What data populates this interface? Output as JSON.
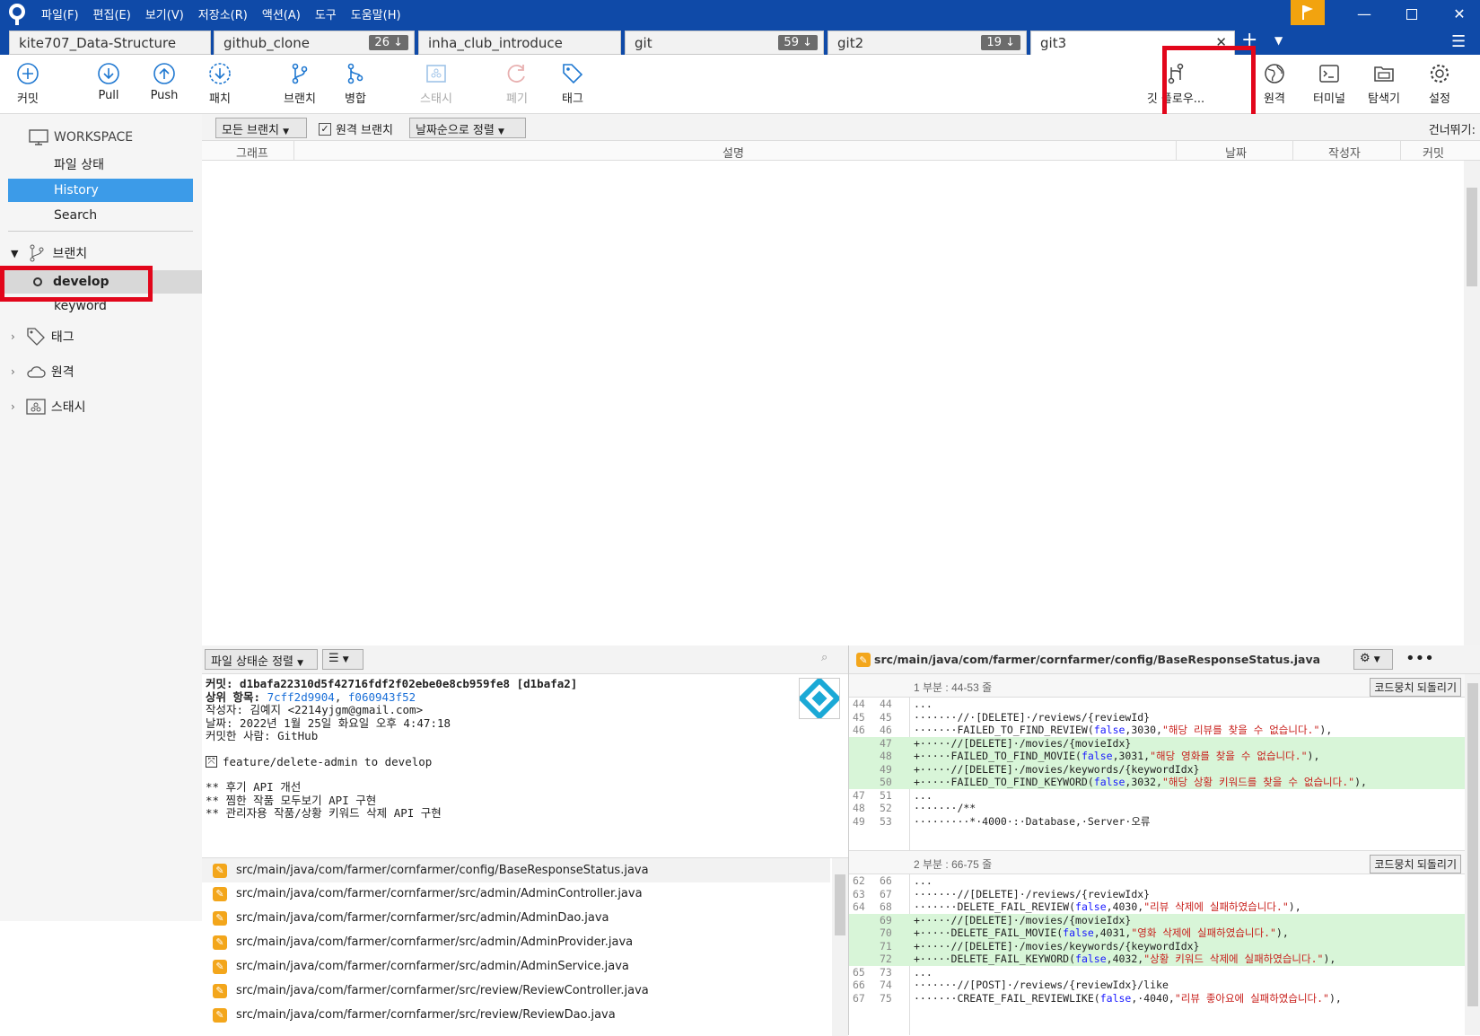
{
  "menu": [
    "파일(F)",
    "편집(E)",
    "보기(V)",
    "저장소(R)",
    "액션(A)",
    "도구",
    "도움말(H)"
  ],
  "tabs": [
    {
      "name": "kite707_Data-Structure",
      "badge": ""
    },
    {
      "name": "github_clone",
      "badge": "26 ↓"
    },
    {
      "name": "inha_club_introduce",
      "badge": ""
    },
    {
      "name": "git",
      "badge": "59 ↓"
    },
    {
      "name": "git2",
      "badge": "19 ↓"
    },
    {
      "name": "git3",
      "badge": ""
    }
  ],
  "toolbar": {
    "commit": "커밋",
    "pull": "Pull",
    "push": "Push",
    "patch": "패치",
    "branch": "브랜치",
    "merge": "병합",
    "stash": "스태시",
    "discard": "폐기",
    "tag": "태그",
    "gitflow": "깃 플로우...",
    "remote": "원격",
    "terminal": "터미널",
    "explorer": "탐색기",
    "settings": "설정"
  },
  "sidebar": {
    "workspace": "WORKSPACE",
    "file_status": "파일 상태",
    "history": "History",
    "search": "Search",
    "branches": "브랜치",
    "branch_items": [
      "develop",
      "keyword"
    ],
    "tags": "태그",
    "remotes": "원격",
    "stashes": "스태시"
  },
  "filter": {
    "branches": "모든 브랜치",
    "remote_branch": "원격 브랜치",
    "sort": "날짜순으로 정렬",
    "jump": "건너뛰기:"
  },
  "columns": {
    "graph": "그래프",
    "desc": "설명",
    "date": "날짜",
    "author": "작성자",
    "commit": "커밋"
  },
  "lower": {
    "sort": "파일 상태순 정렬",
    "filepath": "src/main/java/com/farmer/cornfarmer/config/BaseResponseStatus.java"
  },
  "commit": {
    "hash": "커밋: d1bafa22310d5f42716fdf2f02ebe0e8cb959fe8 [d1bafa2]",
    "parents_label": "상위 항목: ",
    "parent1": "7cff2d9904",
    "parent2": "f060943f52",
    "author": "작성자: 김예지 <2214yjgm@gmail.com>",
    "date": "날짜: 2022년 1월 25일 화요일 오후 4:47:18",
    "committer": "커밋한 사람: GitHub",
    "merge": "feature/delete-admin to develop",
    "notes": [
      "** 후기 API 개선",
      "** 찜한 작품 모두보기 API 구현",
      "** 관리자용 작품/상황 키워드 삭제 API 구현"
    ]
  },
  "files": [
    "src/main/java/com/farmer/cornfarmer/config/BaseResponseStatus.java",
    "src/main/java/com/farmer/cornfarmer/src/admin/AdminController.java",
    "src/main/java/com/farmer/cornfarmer/src/admin/AdminDao.java",
    "src/main/java/com/farmer/cornfarmer/src/admin/AdminProvider.java",
    "src/main/java/com/farmer/cornfarmer/src/admin/AdminService.java",
    "src/main/java/com/farmer/cornfarmer/src/review/ReviewController.java",
    "src/main/java/com/farmer/cornfarmer/src/review/ReviewDao.java"
  ],
  "diff": {
    "revert": "코드뭉치 되돌리기",
    "hunk1_title": "1 부분 : 44-53 줄",
    "hunk1": [
      {
        "a": "44",
        "b": "44",
        "t": "...",
        "add": false
      },
      {
        "a": "45",
        "b": "45",
        "t": "·······//·[DELETE]·/reviews/{reviewId}",
        "add": false
      },
      {
        "a": "46",
        "b": "46",
        "t": "·······FAILED_TO_FIND_REVIEW(false,3030,\"해당 리뷰를 찾을 수 없습니다.\"),",
        "add": false
      },
      {
        "a": "",
        "b": "47",
        "t": "+·····//[DELETE]·/movies/{movieIdx}",
        "add": true
      },
      {
        "a": "",
        "b": "48",
        "t": "+·····FAILED_TO_FIND_MOVIE(false,3031,\"해당 영화를 찾을 수 없습니다.\"),",
        "add": true
      },
      {
        "a": "",
        "b": "49",
        "t": "+·····//[DELETE]·/movies/keywords/{keywordIdx}",
        "add": true
      },
      {
        "a": "",
        "b": "50",
        "t": "+·····FAILED_TO_FIND_KEYWORD(false,3032,\"해당 상황 키워드를 찾을 수 없습니다.\"),",
        "add": true
      },
      {
        "a": "47",
        "b": "51",
        "t": "...",
        "add": false
      },
      {
        "a": "48",
        "b": "52",
        "t": "·······/**",
        "add": false
      },
      {
        "a": "49",
        "b": "53",
        "t": "·········*·4000·:·Database,·Server·오류",
        "add": false
      }
    ],
    "hunk2_title": "2 부분 : 66-75 줄",
    "hunk2": [
      {
        "a": "62",
        "b": "66",
        "t": "...",
        "add": false
      },
      {
        "a": "63",
        "b": "67",
        "t": "·······//[DELETE]·/reviews/{reviewIdx}",
        "add": false
      },
      {
        "a": "64",
        "b": "68",
        "t": "·······DELETE_FAIL_REVIEW(false,4030,\"리뷰 삭제에 실패하였습니다.\"),",
        "add": false
      },
      {
        "a": "",
        "b": "69",
        "t": "+·····//[DELETE]·/movies/{movieIdx}",
        "add": true
      },
      {
        "a": "",
        "b": "70",
        "t": "+·····DELETE_FAIL_MOVIE(false,4031,\"영화 삭제에 실패하였습니다.\"),",
        "add": true
      },
      {
        "a": "",
        "b": "71",
        "t": "+·····//[DELETE]·/movies/keywords/{keywordIdx}",
        "add": true
      },
      {
        "a": "",
        "b": "72",
        "t": "+·····DELETE_FAIL_KEYWORD(false,4032,\"상황 키워드 삭제에 실패하였습니다.\"),",
        "add": true
      },
      {
        "a": "65",
        "b": "73",
        "t": "...",
        "add": false
      },
      {
        "a": "66",
        "b": "74",
        "t": "·······//[POST]·/reviews/{reviewIdx}/like",
        "add": false
      },
      {
        "a": "67",
        "b": "75",
        "t": "·······CREATE_FAIL_REVIEWLIKE(false,·4040,\"리뷰 좋아요에 실패하였습니다.\"),",
        "add": false
      }
    ]
  },
  "colors": {
    "titlebar": "#0f4aa8",
    "selection": "#3c9be8",
    "highlight": "#e2061b",
    "added": "#d8f5d8"
  }
}
